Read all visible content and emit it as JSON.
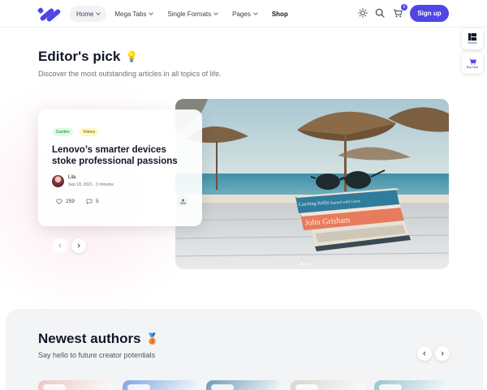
{
  "header": {
    "nav": [
      {
        "label": "Home",
        "dropdown": true,
        "active": true
      },
      {
        "label": "Mega Tabs",
        "dropdown": true
      },
      {
        "label": "Single Formats",
        "dropdown": true
      },
      {
        "label": "Pages",
        "dropdown": true
      },
      {
        "label": "Shop",
        "dropdown": false
      }
    ],
    "icons": [
      "sun-icon",
      "search-icon",
      "cart-icon"
    ],
    "cart_count": "0",
    "signup_label": "Sign up",
    "accent": "#4f46e5"
  },
  "side": {
    "demos_label": "Demos",
    "buy_label": "Buy Now"
  },
  "editors_pick": {
    "title": "Editor's pick",
    "title_emoji": "💡",
    "subtitle": "Discover the most outstanding articles in all topics of life.",
    "post": {
      "tags": [
        "Garden",
        "Videos"
      ],
      "title": "Lenovo’s smarter devices stoke professional passions",
      "author": "Lila",
      "meta": "Sep 18, 2021 · 3 minutes",
      "likes": "259",
      "comments": "5"
    },
    "hero_book_texts": [
      "Catching Kelly",
      "I Started with Grace",
      "John Grisham"
    ],
    "slide_count": 3,
    "active_slide": 1
  },
  "newest_authors": {
    "title": "Newest authors",
    "title_emoji": "🥉",
    "subtitle": "Say hello to future creator potentials",
    "card_colors": [
      "#e9c7c3",
      "#7ea6e0",
      "#6f9bb4",
      "#d9d5cf",
      "#9cc3cf"
    ]
  }
}
